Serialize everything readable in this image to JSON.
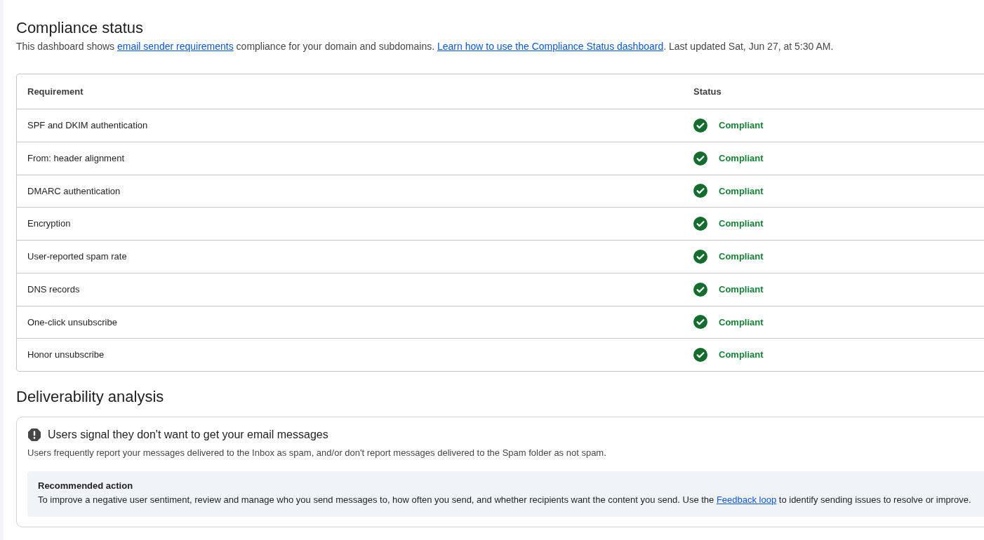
{
  "compliance": {
    "title": "Compliance status",
    "description": [
      {
        "kind": "text",
        "text": "This dashboard shows "
      },
      {
        "kind": "link",
        "text": "email sender requirements"
      },
      {
        "kind": "text",
        "text": " compliance for your domain and subdomains. "
      },
      {
        "kind": "link",
        "text": "Learn how to use the Compliance Status dashboard"
      },
      {
        "kind": "text",
        "text": ". Last updated Sat, Jun 27, at 5:30 AM."
      }
    ]
  },
  "table": {
    "columns": [
      "Requirement",
      "Status"
    ],
    "rows": [
      {
        "requirement": "SPF and DKIM authentication",
        "status": {
          "kind": "compliant",
          "text": "Compliant"
        }
      },
      {
        "requirement": "From: header alignment",
        "status": {
          "kind": "compliant",
          "text": "Compliant"
        }
      },
      {
        "requirement": "DMARC authentication",
        "status": {
          "kind": "compliant",
          "text": "Compliant"
        }
      },
      {
        "requirement": "Encryption",
        "status": {
          "kind": "compliant",
          "text": "Compliant"
        }
      },
      {
        "requirement": "User-reported spam rate",
        "status": {
          "kind": "compliant",
          "text": "Compliant"
        }
      },
      {
        "requirement": "DNS records",
        "status": {
          "kind": "compliant",
          "text": "Compliant"
        }
      },
      {
        "requirement": "One-click unsubscribe",
        "status": {
          "kind": "compliant",
          "text": "Compliant"
        }
      },
      {
        "requirement": "Honor unsubscribe",
        "status": {
          "kind": "compliant",
          "text": "Compliant"
        }
      }
    ]
  },
  "deliverability": {
    "title": "Deliverability analysis",
    "alert": {
      "kind": "warning",
      "title": "Users signal they don't want to get your email messages",
      "description": "Users frequently report your messages delivered to the Inbox as spam, and/or don't report messages delivered to the Spam folder as not spam.",
      "recommendation": {
        "title": "Recommended action",
        "text": [
          {
            "kind": "text",
            "text": "To improve a negative user sentiment, review and manage who you send messages to, how often you send, and whether recipients want the content you send. Use the "
          },
          {
            "kind": "link",
            "text": "Feedback loop"
          },
          {
            "kind": "text",
            "text": " to identify sending issues to resolve or improve."
          }
        ]
      }
    }
  }
}
